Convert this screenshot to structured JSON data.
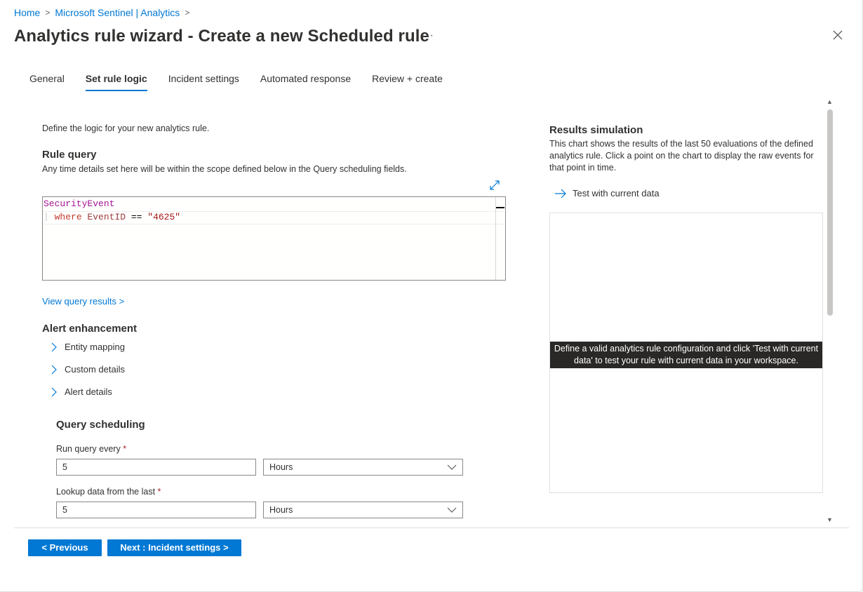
{
  "breadcrumb": {
    "home": "Home",
    "sentinel": "Microsoft Sentinel | Analytics"
  },
  "header": {
    "title": "Analytics rule wizard - Create a new Scheduled rule",
    "more": "···"
  },
  "tabs": [
    {
      "label": "General"
    },
    {
      "label": "Set rule logic"
    },
    {
      "label": "Incident settings"
    },
    {
      "label": "Automated response"
    },
    {
      "label": "Review + create"
    }
  ],
  "active_tab": "Set rule logic",
  "logic": {
    "intro": "Define the logic for your new analytics rule.",
    "rule_query_heading": "Rule query",
    "rule_query_desc": "Any time details set here will be within the scope defined below in the Query scheduling fields.",
    "query_line1": "SecurityEvent",
    "query_line2": {
      "pipe": "| ",
      "kw": "where",
      "field": " EventID",
      "op": " == ",
      "str": "\"4625\""
    },
    "view_results": "View query results >"
  },
  "alert": {
    "heading": "Alert enhancement",
    "items": [
      "Entity mapping",
      "Custom details",
      "Alert details"
    ]
  },
  "scheduling": {
    "heading": "Query scheduling",
    "run_label": "Run query every",
    "run_value": "5",
    "run_unit": "Hours",
    "lookup_label": "Lookup data from the last",
    "lookup_value": "5",
    "lookup_unit": "Hours",
    "required_mark": "*"
  },
  "results": {
    "heading": "Results simulation",
    "desc": "This chart shows the results of the last 50 evaluations of the defined analytics rule. Click a point on the chart to display the raw events for that point in time.",
    "test_label": "Test with current data",
    "message": "Define a valid analytics rule configuration and click 'Test with current data' to test your rule with current data in your workspace."
  },
  "footer": {
    "previous": "< Previous",
    "next": "Next : Incident settings >"
  },
  "colors": {
    "accent": "#0078d4",
    "keyword": "#c0392b",
    "string": "#a31515",
    "table": "#a31595"
  }
}
